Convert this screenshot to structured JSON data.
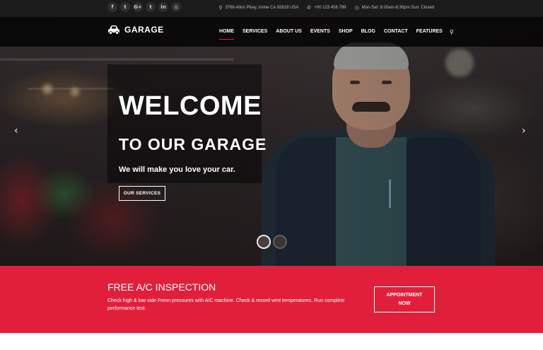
{
  "topbar": {
    "socials": [
      {
        "icon": "facebook-icon",
        "glyph": "f"
      },
      {
        "icon": "twitter-icon",
        "glyph": "t"
      },
      {
        "icon": "google-plus-icon",
        "glyph": "G+"
      },
      {
        "icon": "tumblr-icon",
        "glyph": "t"
      },
      {
        "icon": "linkedin-icon",
        "glyph": "in"
      },
      {
        "icon": "instagram-icon",
        "glyph": "◎"
      }
    ],
    "address": "3766 Alton Pkwy, Irvine CA 92618 USA",
    "phone": "+00 123 456 789",
    "hours": "Mon-Sat: 8:00am-6:30pm  Sun: Closed"
  },
  "header": {
    "logo_text": "GARAGE",
    "nav": [
      {
        "label": "HOME",
        "active": true
      },
      {
        "label": "SERVICES",
        "active": false
      },
      {
        "label": "ABOUT US",
        "active": false
      },
      {
        "label": "EVENTS",
        "active": false
      },
      {
        "label": "SHOP",
        "active": false
      },
      {
        "label": "BLOG",
        "active": false
      },
      {
        "label": "CONTACT",
        "active": false
      },
      {
        "label": "FEATURES",
        "active": false
      }
    ]
  },
  "hero": {
    "title": "WELCOME",
    "subtitle": "TO OUR GARAGE",
    "tagline": "We will make you love your car.",
    "button_label": "OUR SERVICES",
    "prev_glyph": "‹",
    "next_glyph": "›"
  },
  "banner": {
    "title": "FREE A/C INSPECTION",
    "description": "Check high & low side Freon pressures with A/C machine. Check & record vent temperatures. Run complete performance test.",
    "button_line1": "APPOINTMENT",
    "button_line2": "NOW"
  },
  "colors": {
    "accent": "#e21f3b",
    "topbar_bg": "#1b1b1b"
  }
}
